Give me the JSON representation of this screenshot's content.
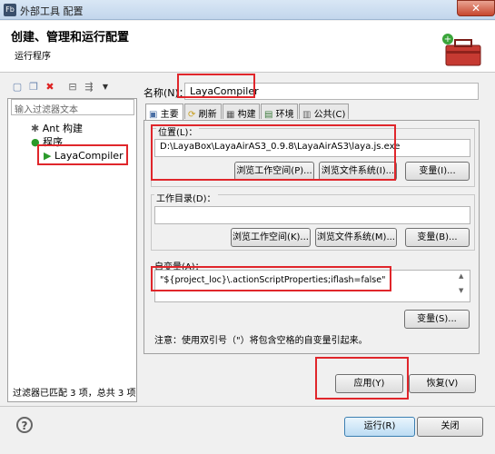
{
  "window": {
    "icon": "Fb",
    "title": "外部工具 配置",
    "close": "✕"
  },
  "header": {
    "title": "创建、管理和运行配置",
    "subtitle": "运行程序"
  },
  "left": {
    "filter_placeholder": "输入过滤器文本",
    "tree": [
      {
        "label": "Ant 构建",
        "icon": "ant-icon"
      },
      {
        "label": "程序",
        "icon": "program-icon"
      },
      {
        "label": "LayaCompiler",
        "icon": "launch-config-icon"
      }
    ],
    "status": "过滤器已匹配 3 项，总共 3 项"
  },
  "name": {
    "label": "名称(N)：",
    "value": "LayaCompiler"
  },
  "tabs": [
    "主要",
    "刷新",
    "构建",
    "环境",
    "公共(C)"
  ],
  "main": {
    "location_label": "位置(L)：",
    "location_value": "D:\\LayaBox\\LayaAirAS3_0.9.8\\LayaAirAS3\\laya.js.exe",
    "browse_workspace": "浏览工作空间(P)...",
    "browse_filesystem": "浏览文件系统(I)...",
    "variables": "变量(I)...",
    "workdir_label": "工作目录(D)：",
    "workdir_value": "",
    "browse_workspace2": "浏览工作空间(K)...",
    "browse_filesystem2": "浏览文件系统(M)...",
    "variables2": "变量(B)...",
    "args_label": "自变量(A)：",
    "args_value": "\"${project_loc}\\.actionScriptProperties;iflash=false\"",
    "variables3": "变量(S)...",
    "note": "注意：使用双引号（\"）将包含空格的自变量引起来。"
  },
  "buttons": {
    "apply": "应用(Y)",
    "revert": "恢复(V)",
    "run": "运行(R)",
    "close": "关闭"
  },
  "colors": {
    "highlight": "#e0262b",
    "accent": "#3c7fb1"
  }
}
